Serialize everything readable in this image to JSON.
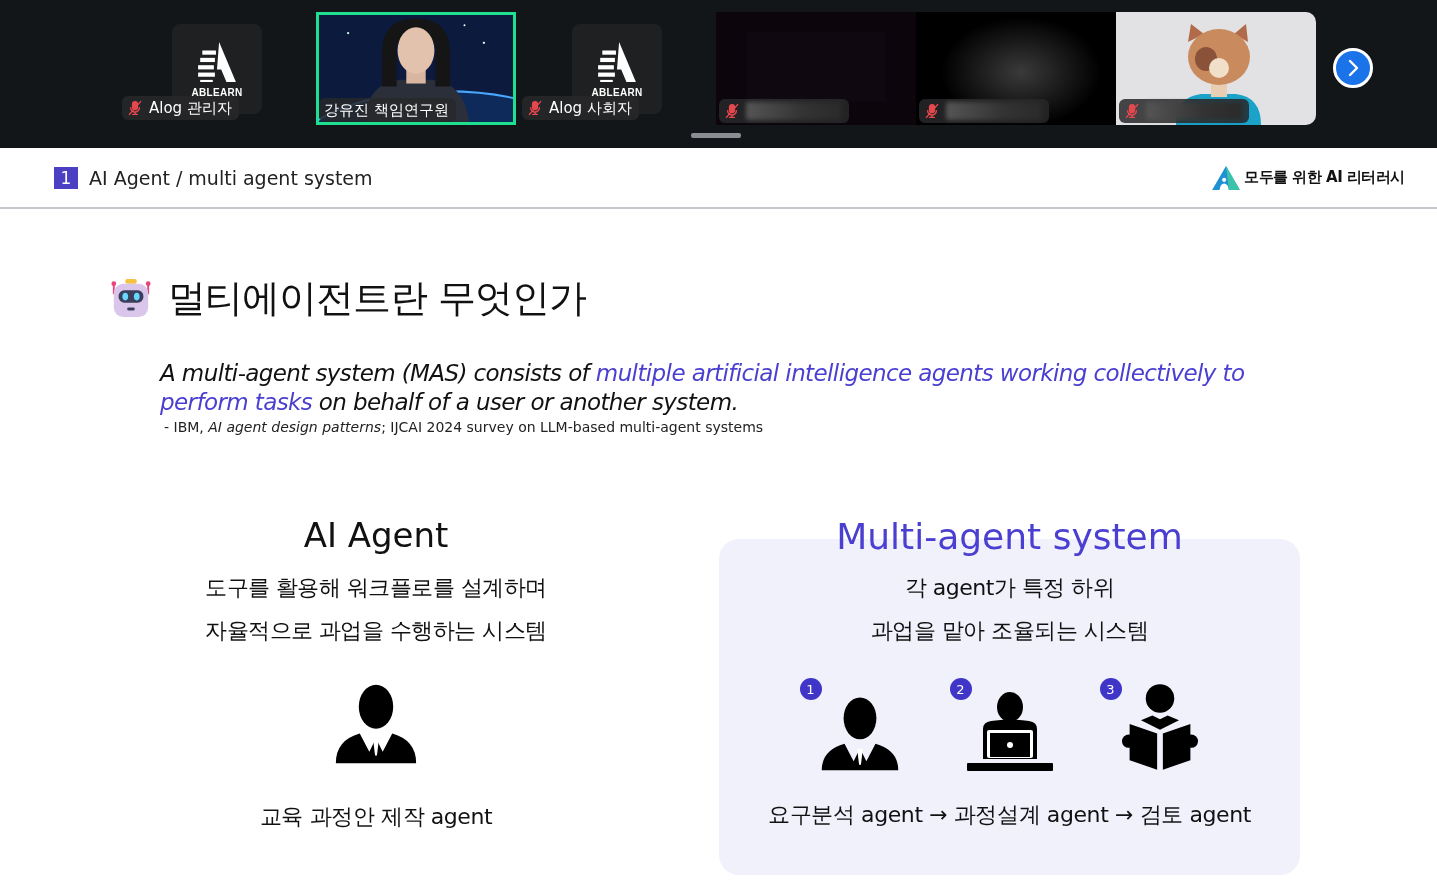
{
  "participants": [
    {
      "kind": "avatar",
      "logo": "ABLEARN",
      "name": "Alog 관리자",
      "muted": true,
      "selected": false
    },
    {
      "kind": "video",
      "name": "강유진 책임연구원",
      "muted": false,
      "selected": true
    },
    {
      "kind": "avatar",
      "logo": "ABLEARN",
      "name": "Alog 사회자",
      "muted": true,
      "selected": false
    },
    {
      "kind": "video",
      "muted": true,
      "selected": false
    },
    {
      "kind": "video",
      "muted": true,
      "selected": false
    },
    {
      "kind": "video",
      "muted": true,
      "selected": false
    }
  ],
  "slide": {
    "section_number": "1",
    "section_title": "AI Agent / multi agent system",
    "brand": "모두를 위한 AI 리터러시",
    "title": "멀티에이전트란 무엇인가",
    "quote": [
      {
        "text": "A multi-agent system (MAS) consists of ",
        "highlight": false
      },
      {
        "text": "multiple artificial intelligence agents working collectively to perform tasks",
        "highlight": true
      },
      {
        "text": " on behalf of a user or another system.",
        "highlight": false
      }
    ],
    "source": "- IBM, *AI agent design patterns*; IJCAI 2024 survey on LLM-based multi-agent systems",
    "single_agent": {
      "title": "AI Agent",
      "lines": [
        "도구를 활용해 워크플로를 설계하며",
        "자율적으로 과업을 수행하는 시스템"
      ],
      "caption": "교육 과정안 제작 agent"
    },
    "multi_agent": {
      "title": "Multi-agent system",
      "lines": [
        "각 agent가 특정 하위",
        "과업을 맡아 조율되는 시스템"
      ],
      "agents": [
        {
          "number": "1",
          "kind": "manager"
        },
        {
          "number": "2",
          "kind": "laptop"
        },
        {
          "number": "3",
          "kind": "reader"
        }
      ],
      "caption": "요구분석 agent → 과정설계 agent → 검토 agent"
    }
  }
}
